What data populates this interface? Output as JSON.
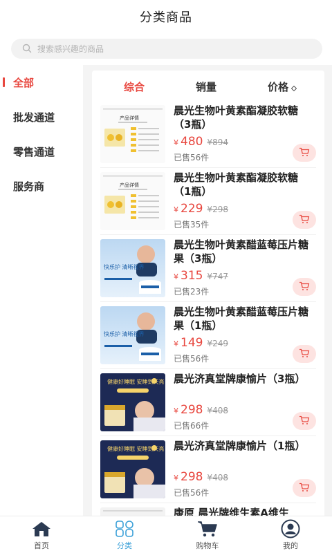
{
  "header": {
    "title": "分类商品"
  },
  "search": {
    "placeholder": "搜索感兴趣的商品"
  },
  "sidebar": {
    "items": [
      {
        "label": "全部",
        "active": true
      },
      {
        "label": "批发通道"
      },
      {
        "label": "零售通道"
      },
      {
        "label": "服务商"
      }
    ]
  },
  "sort": {
    "comprehensive": "综合",
    "sales": "销量",
    "price": "价格"
  },
  "colors": {
    "accent": "#e8473f",
    "tab_active": "#3aa0d8",
    "cart_bg": "#fde3e1"
  },
  "products": [
    {
      "name": "晨光生物叶黄素酯凝胶软糖（3瓶）",
      "currency": "¥",
      "price": "480",
      "original": "¥894",
      "sold": "已售56件",
      "thumb_text": "产品详情"
    },
    {
      "name": "晨光生物叶黄素酯凝胶软糖（1瓶）",
      "currency": "¥",
      "price": "229",
      "original": "¥298",
      "sold": "已售35件",
      "thumb_text": "产品详情"
    },
    {
      "name": "晨光生物叶黄素醋蓝莓压片糖果（3瓶）",
      "currency": "¥",
      "price": "315",
      "original": "¥747",
      "sold": "已售23件",
      "thumb_text": "快乐护 清晰视界"
    },
    {
      "name": "晨光生物叶黄素醋蓝莓压片糖果（1瓶）",
      "currency": "¥",
      "price": "149",
      "original": "¥249",
      "sold": "已售56件",
      "thumb_text": "快乐护 清晰视界"
    },
    {
      "name": "晨光济真堂牌康愉片（3瓶）",
      "currency": "¥",
      "price": "298",
      "original": "¥408",
      "sold": "已售66件",
      "thumb_text": "健康好睡眠 安睡到天亮"
    },
    {
      "name": "晨光济真堂牌康愉片（1瓶）",
      "currency": "¥",
      "price": "298",
      "original": "¥408",
      "sold": "已售56件",
      "thumb_text": "健康好睡眠 安睡到天亮"
    },
    {
      "name": "康原 晨光牌维生素A维生",
      "currency": "",
      "price": "",
      "original": "",
      "sold": "",
      "thumb_text": ""
    }
  ],
  "tabbar": {
    "items": [
      {
        "label": "首页",
        "icon": "home-icon"
      },
      {
        "label": "分类",
        "icon": "category-icon",
        "active": true
      },
      {
        "label": "购物车",
        "icon": "cart-icon"
      },
      {
        "label": "我的",
        "icon": "profile-icon"
      }
    ]
  }
}
